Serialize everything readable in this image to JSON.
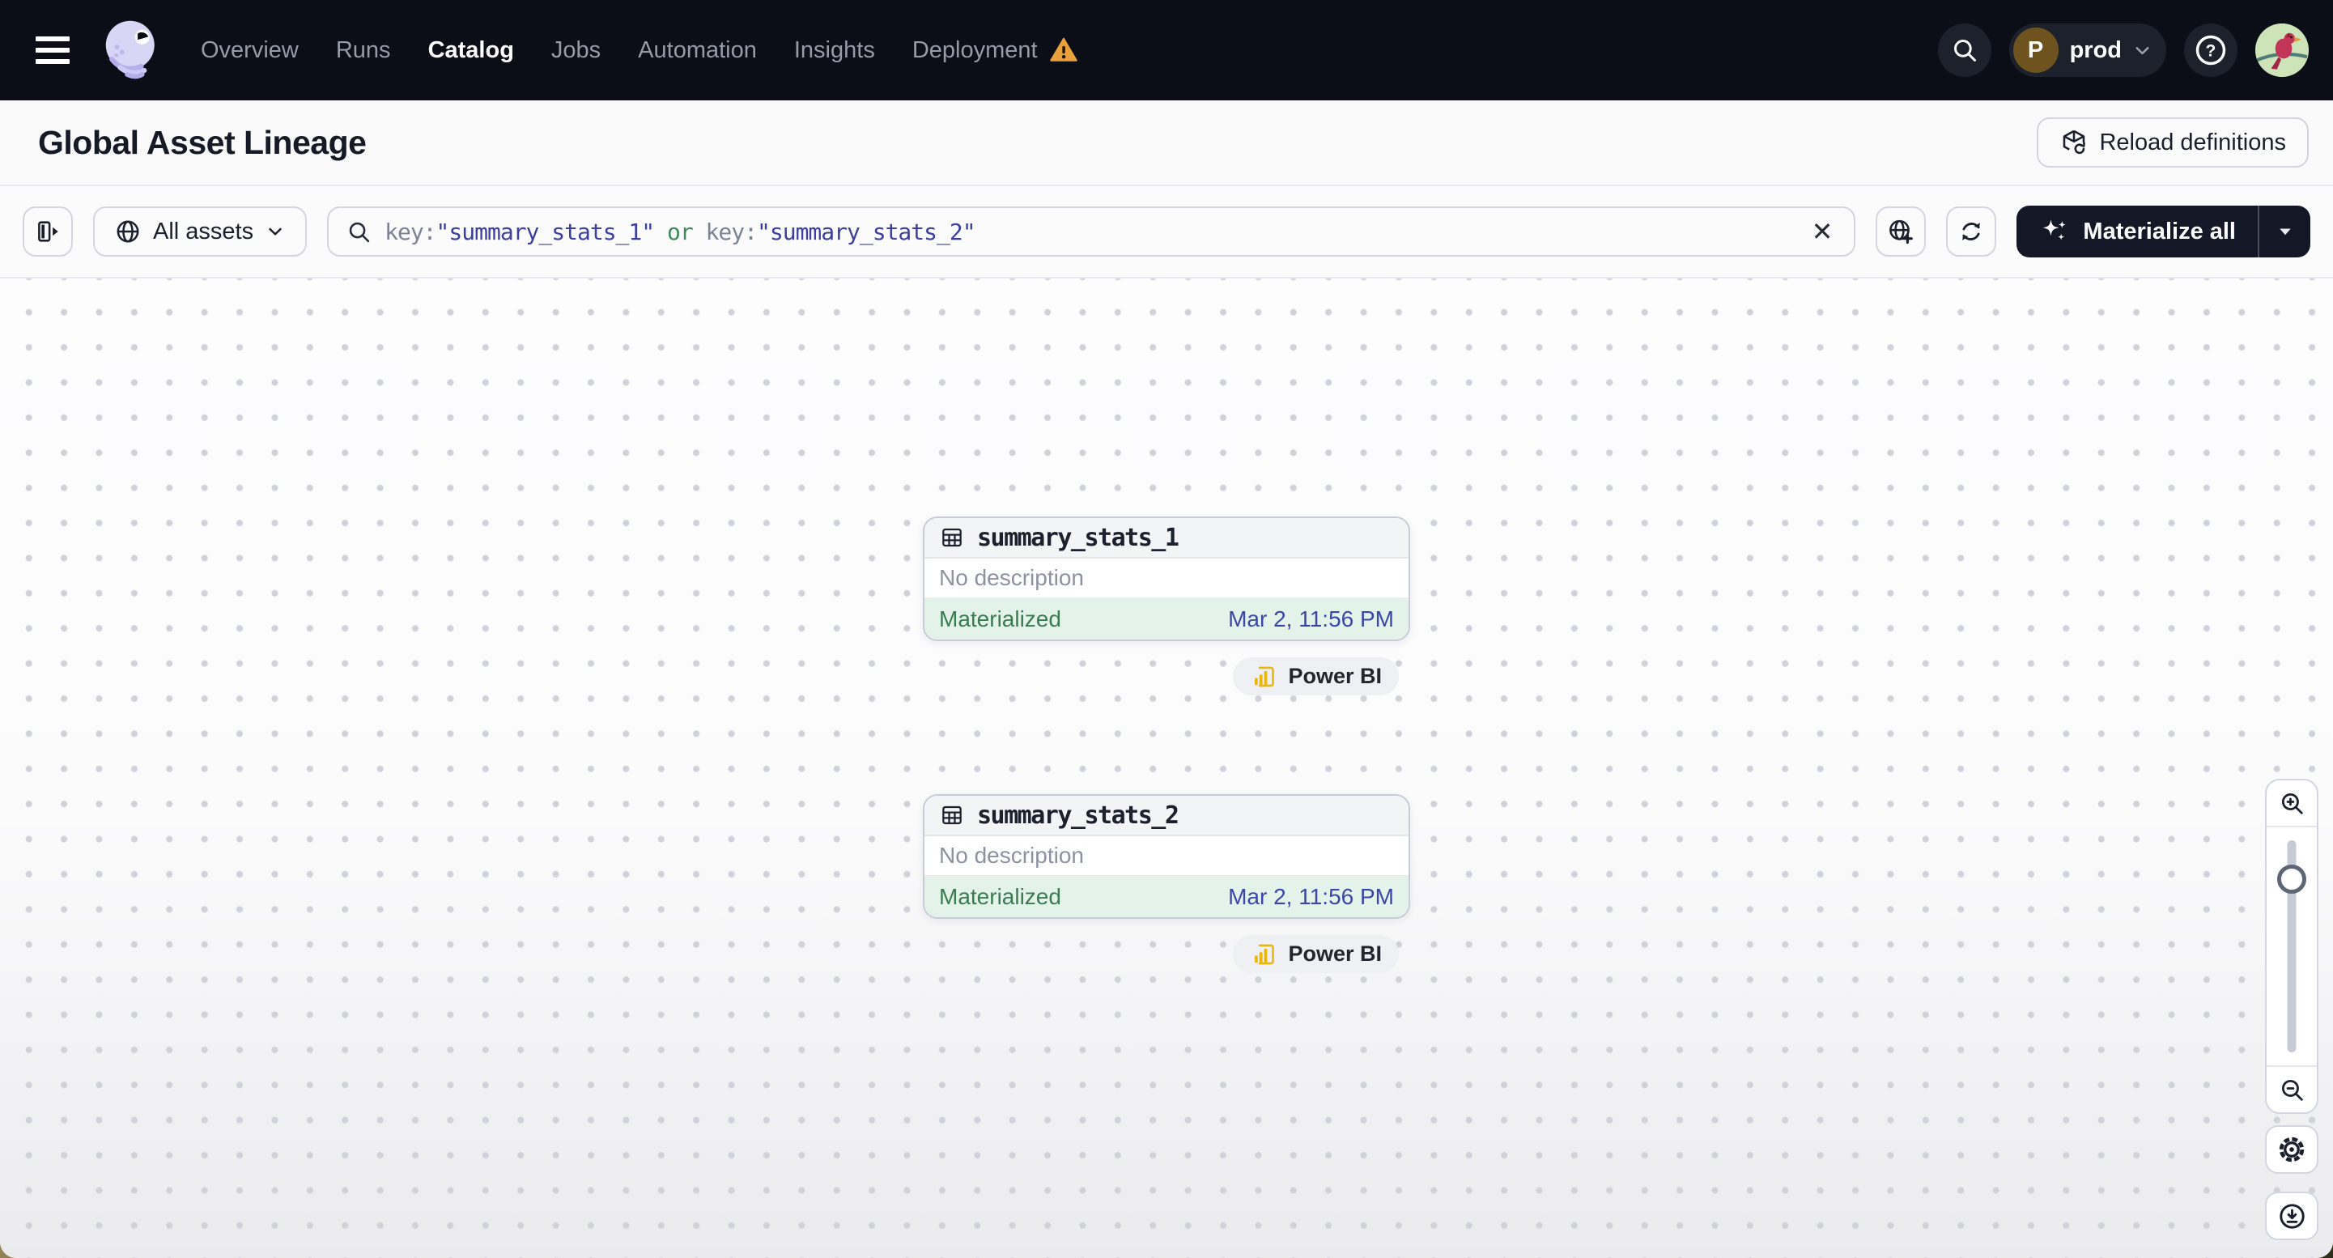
{
  "nav": {
    "menu": [
      "Overview",
      "Runs",
      "Catalog",
      "Jobs",
      "Automation",
      "Insights",
      "Deployment"
    ],
    "active_item": "Catalog",
    "deployment_has_warning": true,
    "env": {
      "initial": "P",
      "name": "prod"
    }
  },
  "header": {
    "title": "Global Asset Lineage",
    "reload_label": "Reload definitions"
  },
  "toolbar": {
    "filter_label": "All assets",
    "materialize_label": "Materialize all",
    "query": [
      {
        "t": "key:"
      },
      {
        "t": "\"summary_stats_1\""
      },
      {
        "t": " or "
      },
      {
        "t": "key:"
      },
      {
        "t": "\"summary_stats_2\""
      }
    ]
  },
  "graph": {
    "nodes": [
      {
        "name": "summary_stats_1",
        "description": "No description",
        "status": "Materialized",
        "materialized_at": "Mar 2, 11:56 PM",
        "tag": "Power BI"
      },
      {
        "name": "summary_stats_2",
        "description": "No description",
        "status": "Materialized",
        "materialized_at": "Mar 2, 11:56 PM",
        "tag": "Power BI"
      }
    ]
  },
  "icons": {
    "close": "✕",
    "help": "?"
  },
  "colors": {
    "navbar_bg": "#0b0d17",
    "status_green": "#3a7b51",
    "status_bg": "#e4f3e9",
    "timestamp_blue": "#3a46a8",
    "warning_orange": "#e9a23b",
    "powerbi_yellow": "#e9b60d",
    "accent_dark": "#141826"
  }
}
